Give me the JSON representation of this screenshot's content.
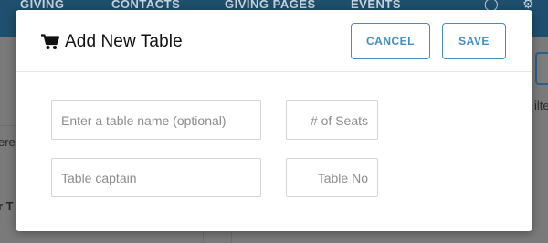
{
  "background": {
    "nav_items": [
      "GIVING",
      "CONTACTS",
      "GIVING PAGES",
      "EVENTS"
    ],
    "side_text_1": "ere",
    "side_text_2": "r T",
    "side_text_3": "ilte"
  },
  "modal": {
    "icon": "cart-icon",
    "title": "Add New Table",
    "cancel_label": "CANCEL",
    "save_label": "SAVE",
    "fields": {
      "table_name_placeholder": "Enter a table name (optional)",
      "seats_placeholder": "# of Seats",
      "captain_placeholder": "Table captain",
      "table_no_placeholder": "Table No"
    }
  },
  "colors": {
    "accent": "#3f8fc4",
    "nav_bg": "#1e4f6e",
    "overlay": "#7d7d7d"
  }
}
